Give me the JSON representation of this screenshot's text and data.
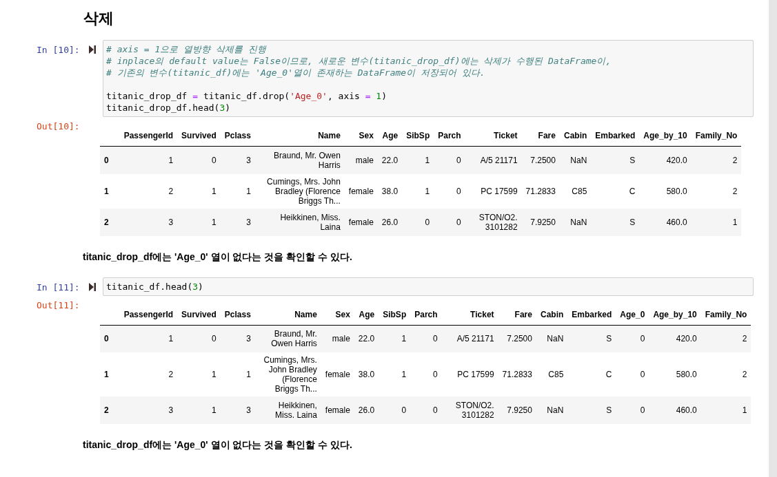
{
  "heading": "삭제",
  "cells": [
    {
      "kind": "code",
      "prompt": "In [10]:",
      "code": [
        {
          "tokens": [
            {
              "kind": "comment",
              "text": "# axis = 1으로 열방향 삭제를 진행"
            }
          ]
        },
        {
          "tokens": [
            {
              "kind": "comment",
              "text": "# inplace의 default value는 False이므로, 새로운 변수(titanic_drop_df)에는 삭제가 수행된 DataFrame이,"
            }
          ]
        },
        {
          "tokens": [
            {
              "kind": "comment",
              "text": "# 기존의 변수(titanic_df)에는 'Age_0'열이 존재하는 DataFrame이 저장되어 있다."
            }
          ]
        },
        {
          "kind": "blank"
        },
        {
          "tokens": [
            {
              "kind": "name",
              "text": "titanic_drop_df "
            },
            {
              "kind": "op",
              "text": "="
            },
            {
              "kind": "name",
              "text": " titanic_df.drop("
            },
            {
              "kind": "string",
              "text": "'Age_0'"
            },
            {
              "kind": "name",
              "text": ", axis "
            },
            {
              "kind": "op",
              "text": "="
            },
            {
              "kind": "number",
              "text": " 1"
            },
            {
              "kind": "name",
              "text": ")"
            }
          ]
        },
        {
          "tokens": [
            {
              "kind": "name",
              "text": "titanic_drop_df.head("
            },
            {
              "kind": "number",
              "text": "3"
            },
            {
              "kind": "name",
              "text": ")"
            }
          ]
        }
      ],
      "output": {
        "prompt": "Out[10]:",
        "columns": [
          "PassengerId",
          "Survived",
          "Pclass",
          "Name",
          "Sex",
          "Age",
          "SibSp",
          "Parch",
          "Ticket",
          "Fare",
          "Cabin",
          "Embarked",
          "Age_by_10",
          "Family_No"
        ],
        "rows": [
          {
            "index": "0",
            "cells": [
              "1",
              "0",
              "3",
              "Braund, Mr. Owen Harris",
              "male",
              "22.0",
              "1",
              "0",
              "A/5 21171",
              "7.2500",
              "NaN",
              "S",
              "420.0",
              "2"
            ]
          },
          {
            "index": "1",
            "cells": [
              "2",
              "1",
              "1",
              "Cumings, Mrs. John Bradley (Florence Briggs Th...",
              "female",
              "38.0",
              "1",
              "0",
              "PC 17599",
              "71.2833",
              "C85",
              "C",
              "580.0",
              "2"
            ]
          },
          {
            "index": "2",
            "cells": [
              "3",
              "1",
              "3",
              "Heikkinen, Miss. Laina",
              "female",
              "26.0",
              "0",
              "0",
              "STON/O2. 3101282",
              "7.9250",
              "NaN",
              "S",
              "460.0",
              "1"
            ]
          }
        ]
      }
    },
    {
      "kind": "markdown",
      "text": "titanic_drop_df에는 'Age_0' 열이 없다는 것을 확인할 수 있다."
    },
    {
      "kind": "code",
      "prompt": "In [11]:",
      "code": [
        {
          "tokens": [
            {
              "kind": "name",
              "text": "titanic_df.head("
            },
            {
              "kind": "number",
              "text": "3"
            },
            {
              "kind": "name",
              "text": ")"
            }
          ]
        }
      ],
      "output": {
        "prompt": "Out[11]:",
        "columns": [
          "PassengerId",
          "Survived",
          "Pclass",
          "Name",
          "Sex",
          "Age",
          "SibSp",
          "Parch",
          "Ticket",
          "Fare",
          "Cabin",
          "Embarked",
          "Age_0",
          "Age_by_10",
          "Family_No"
        ],
        "rows": [
          {
            "index": "0",
            "cells": [
              "1",
              "0",
              "3",
              "Braund, Mr. Owen Harris",
              "male",
              "22.0",
              "1",
              "0",
              "A/5 21171",
              "7.2500",
              "NaN",
              "S",
              "0",
              "420.0",
              "2"
            ]
          },
          {
            "index": "1",
            "cells": [
              "2",
              "1",
              "1",
              "Cumings, Mrs. John Bradley (Florence Briggs Th...",
              "female",
              "38.0",
              "1",
              "0",
              "PC 17599",
              "71.2833",
              "C85",
              "C",
              "0",
              "580.0",
              "2"
            ]
          },
          {
            "index": "2",
            "cells": [
              "3",
              "1",
              "3",
              "Heikkinen, Miss. Laina",
              "female",
              "26.0",
              "0",
              "0",
              "STON/O2. 3101282",
              "7.9250",
              "NaN",
              "S",
              "0",
              "460.0",
              "1"
            ]
          }
        ]
      }
    },
    {
      "kind": "markdown",
      "text": "titanic_drop_df에는 'Age_0' 열이 없다는 것을 확인할 수 있다."
    }
  ]
}
